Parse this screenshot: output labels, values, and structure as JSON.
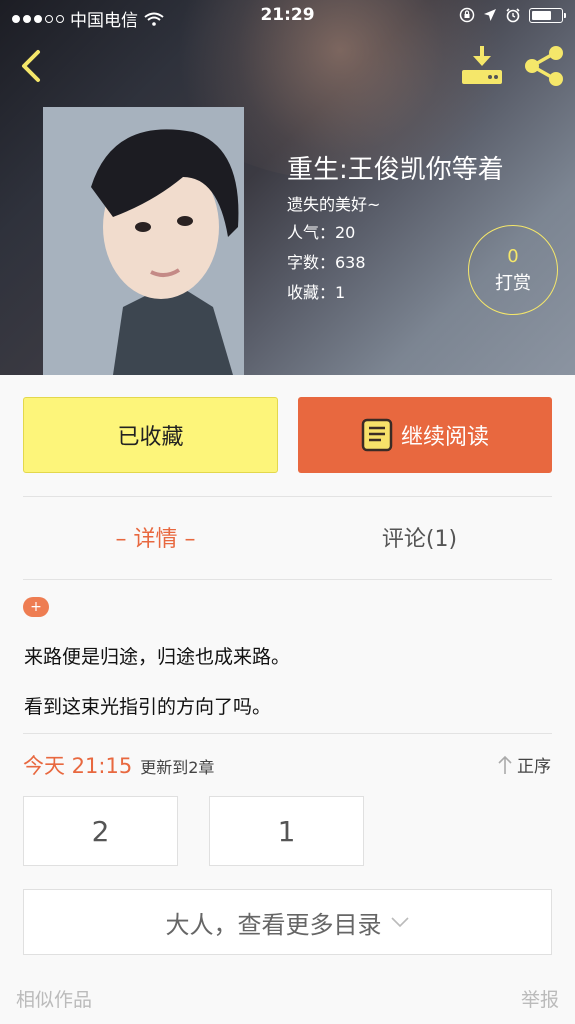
{
  "status_bar": {
    "carrier": "中国电信",
    "time": "21:29"
  },
  "book": {
    "title": "重生:王俊凯你等着",
    "author": "遗失的美好~",
    "popularity": "人气：20",
    "word_count": "字数：638",
    "favorites": "收藏：1"
  },
  "reward": {
    "count": "0",
    "label": "打赏"
  },
  "actions": {
    "favorited_label": "已收藏",
    "continue_label": "继续阅读"
  },
  "tabs": [
    {
      "label": "– 详情 –"
    },
    {
      "label": "评论(1)"
    }
  ],
  "detail": {
    "tag": "+",
    "lines": [
      "来路便是归途，归途也成来路。",
      "看到这束光指引的方向了吗。"
    ]
  },
  "update": {
    "time": "今天 21:15",
    "text": "更新到2章",
    "order_label": "正序"
  },
  "chapters": [
    {
      "label": "2"
    },
    {
      "label": "1"
    }
  ],
  "more_label": "大人，查看更多目录",
  "footer": {
    "similar_label": "相似作品",
    "report_label": "举报"
  },
  "colors": {
    "accent_orange": "#e8683f",
    "favorite_yellow": "#fdf57a",
    "icon_yellow": "#f5e76a"
  }
}
